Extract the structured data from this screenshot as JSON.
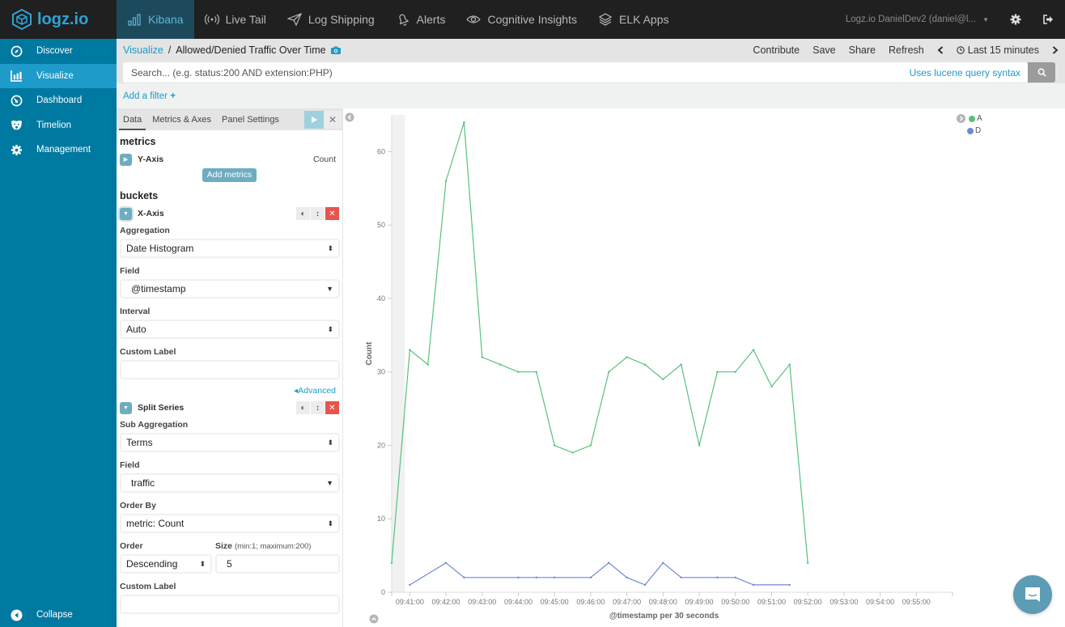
{
  "topbar": {
    "brand": "logz.io",
    "nav": [
      {
        "label": "Kibana",
        "icon": "bar-chart-icon",
        "active": true
      },
      {
        "label": "Live Tail",
        "icon": "broadcast-icon",
        "active": false
      },
      {
        "label": "Log Shipping",
        "icon": "paper-plane-icon",
        "active": false
      },
      {
        "label": "Alerts",
        "icon": "bell-icon",
        "active": false
      },
      {
        "label": "Cognitive Insights",
        "icon": "eye-icon",
        "active": false
      },
      {
        "label": "ELK Apps",
        "icon": "layers-icon",
        "active": false
      }
    ],
    "account": "Logz.io DanielDev2 (daniel@l...",
    "account_caret": "▼"
  },
  "sidebar": {
    "items": [
      {
        "label": "Discover",
        "icon": "compass-icon",
        "active": false
      },
      {
        "label": "Visualize",
        "icon": "bar-chart-icon",
        "active": true
      },
      {
        "label": "Dashboard",
        "icon": "gauge-icon",
        "active": false
      },
      {
        "label": "Timelion",
        "icon": "timelion-icon",
        "active": false
      },
      {
        "label": "Management",
        "icon": "gear-icon",
        "active": false
      }
    ],
    "collapse": "Collapse"
  },
  "header": {
    "crumb_link": "Visualize",
    "crumb_sep": "/",
    "title": "Allowed/Denied Traffic Over Time",
    "actions": [
      "Contribute",
      "Save",
      "Share",
      "Refresh"
    ],
    "time_range": "Last 15 minutes"
  },
  "search": {
    "placeholder": "Search... (e.g. status:200 AND extension:PHP)",
    "value": "",
    "syntax_link": "Uses lucene query syntax"
  },
  "filter": {
    "add_label": "Add a filter",
    "plus": "+"
  },
  "editor": {
    "tabs": [
      "Data",
      "Metrics & Axes",
      "Panel Settings"
    ],
    "active_tab": "Data",
    "metrics_title": "metrics",
    "y_axis": {
      "label": "Y-Axis",
      "value": "Count"
    },
    "add_metrics": "Add metrics",
    "buckets_title": "buckets",
    "x_axis": {
      "label": "X-Axis",
      "aggregation_label": "Aggregation",
      "aggregation": "Date Histogram",
      "field_label": "Field",
      "field": "@timestamp",
      "interval_label": "Interval",
      "interval": "Auto",
      "custom_label_label": "Custom Label",
      "custom_label": ""
    },
    "advanced": "Advanced",
    "split": {
      "label": "Split Series",
      "sub_agg_label": "Sub Aggregation",
      "sub_agg": "Terms",
      "field_label": "Field",
      "field": "traffic",
      "order_by_label": "Order By",
      "order_by": "metric: Count",
      "order_label": "Order",
      "order": "Descending",
      "size_label": "Size",
      "size_hint": "(min:1; maximum:200)",
      "size": "5",
      "custom_label_label": "Custom Label",
      "custom_label": ""
    }
  },
  "chart_data": {
    "type": "line",
    "title": "",
    "xlabel": "@timestamp per 30 seconds",
    "ylabel": "Count",
    "ylim": [
      0,
      65
    ],
    "yticks": [
      0,
      10,
      20,
      30,
      40,
      50,
      60
    ],
    "xticks": [
      "09:41:00",
      "09:42:00",
      "09:43:00",
      "09:44:00",
      "09:45:00",
      "09:46:00",
      "09:47:00",
      "09:48:00",
      "09:49:00",
      "09:50:00",
      "09:51:00",
      "09:52:00",
      "09:53:00",
      "09:54:00",
      "09:55:00"
    ],
    "xrange": [
      "09:40:30",
      "09:56:00"
    ],
    "partial_bucket_until": "09:40:52",
    "legend_position": "top-right",
    "series": [
      {
        "name": "A",
        "color": "#57c17b",
        "points": [
          [
            "09:40:30",
            4
          ],
          [
            "09:41:00",
            33
          ],
          [
            "09:41:30",
            31
          ],
          [
            "09:42:00",
            56
          ],
          [
            "09:42:30",
            64
          ],
          [
            "09:43:00",
            32
          ],
          [
            "09:43:30",
            31
          ],
          [
            "09:44:00",
            30
          ],
          [
            "09:44:30",
            30
          ],
          [
            "09:45:00",
            20
          ],
          [
            "09:45:30",
            19
          ],
          [
            "09:46:00",
            20
          ],
          [
            "09:46:30",
            30
          ],
          [
            "09:47:00",
            32
          ],
          [
            "09:47:30",
            31
          ],
          [
            "09:48:00",
            29
          ],
          [
            "09:48:30",
            31
          ],
          [
            "09:49:00",
            20
          ],
          [
            "09:49:30",
            30
          ],
          [
            "09:50:00",
            30
          ],
          [
            "09:50:30",
            33
          ],
          [
            "09:51:00",
            28
          ],
          [
            "09:51:30",
            31
          ],
          [
            "09:52:00",
            4
          ]
        ]
      },
      {
        "name": "D",
        "color": "#6f87d8",
        "points": [
          [
            "09:41:00",
            1
          ],
          [
            "09:42:00",
            4
          ],
          [
            "09:42:30",
            2
          ],
          [
            "09:44:00",
            2
          ],
          [
            "09:44:30",
            2
          ],
          [
            "09:45:00",
            2
          ],
          [
            "09:46:00",
            2
          ],
          [
            "09:46:30",
            4
          ],
          [
            "09:47:00",
            2
          ],
          [
            "09:47:30",
            1
          ],
          [
            "09:48:00",
            4
          ],
          [
            "09:48:30",
            2
          ],
          [
            "09:49:30",
            2
          ],
          [
            "09:50:00",
            2
          ],
          [
            "09:50:30",
            1
          ],
          [
            "09:51:30",
            1
          ]
        ]
      }
    ]
  }
}
